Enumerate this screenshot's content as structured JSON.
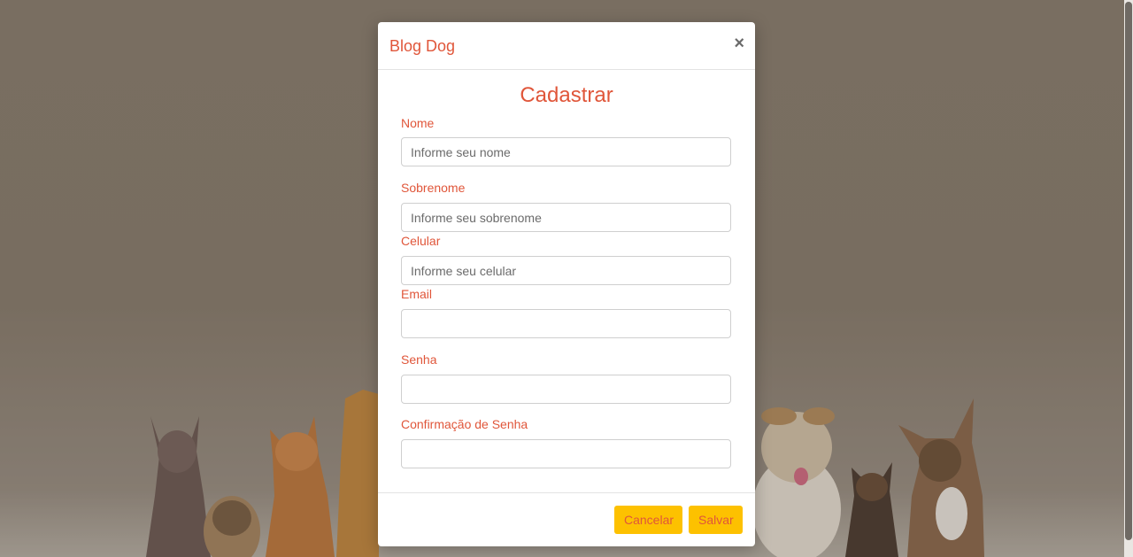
{
  "modal": {
    "title": "Blog Dog",
    "close_symbol": "×",
    "heading": "Cadastrar"
  },
  "form": {
    "nome": {
      "label": "Nome",
      "placeholder": "Informe seu nome"
    },
    "sobrenome": {
      "label": "Sobrenome",
      "placeholder": "Informe seu sobrenome"
    },
    "celular": {
      "label": "Celular",
      "placeholder": "Informe seu celular"
    },
    "email": {
      "label": "Email",
      "placeholder": ""
    },
    "senha": {
      "label": "Senha",
      "placeholder": ""
    },
    "confirmacao": {
      "label": "Confirmação de Senha",
      "placeholder": ""
    }
  },
  "footer": {
    "cancel_label": "Cancelar",
    "save_label": "Salvar"
  },
  "colors": {
    "accent": "#e0563a",
    "button": "#fdc100",
    "backdrop": "#8b7f71"
  },
  "background": {
    "image": "pets-group-photo"
  }
}
